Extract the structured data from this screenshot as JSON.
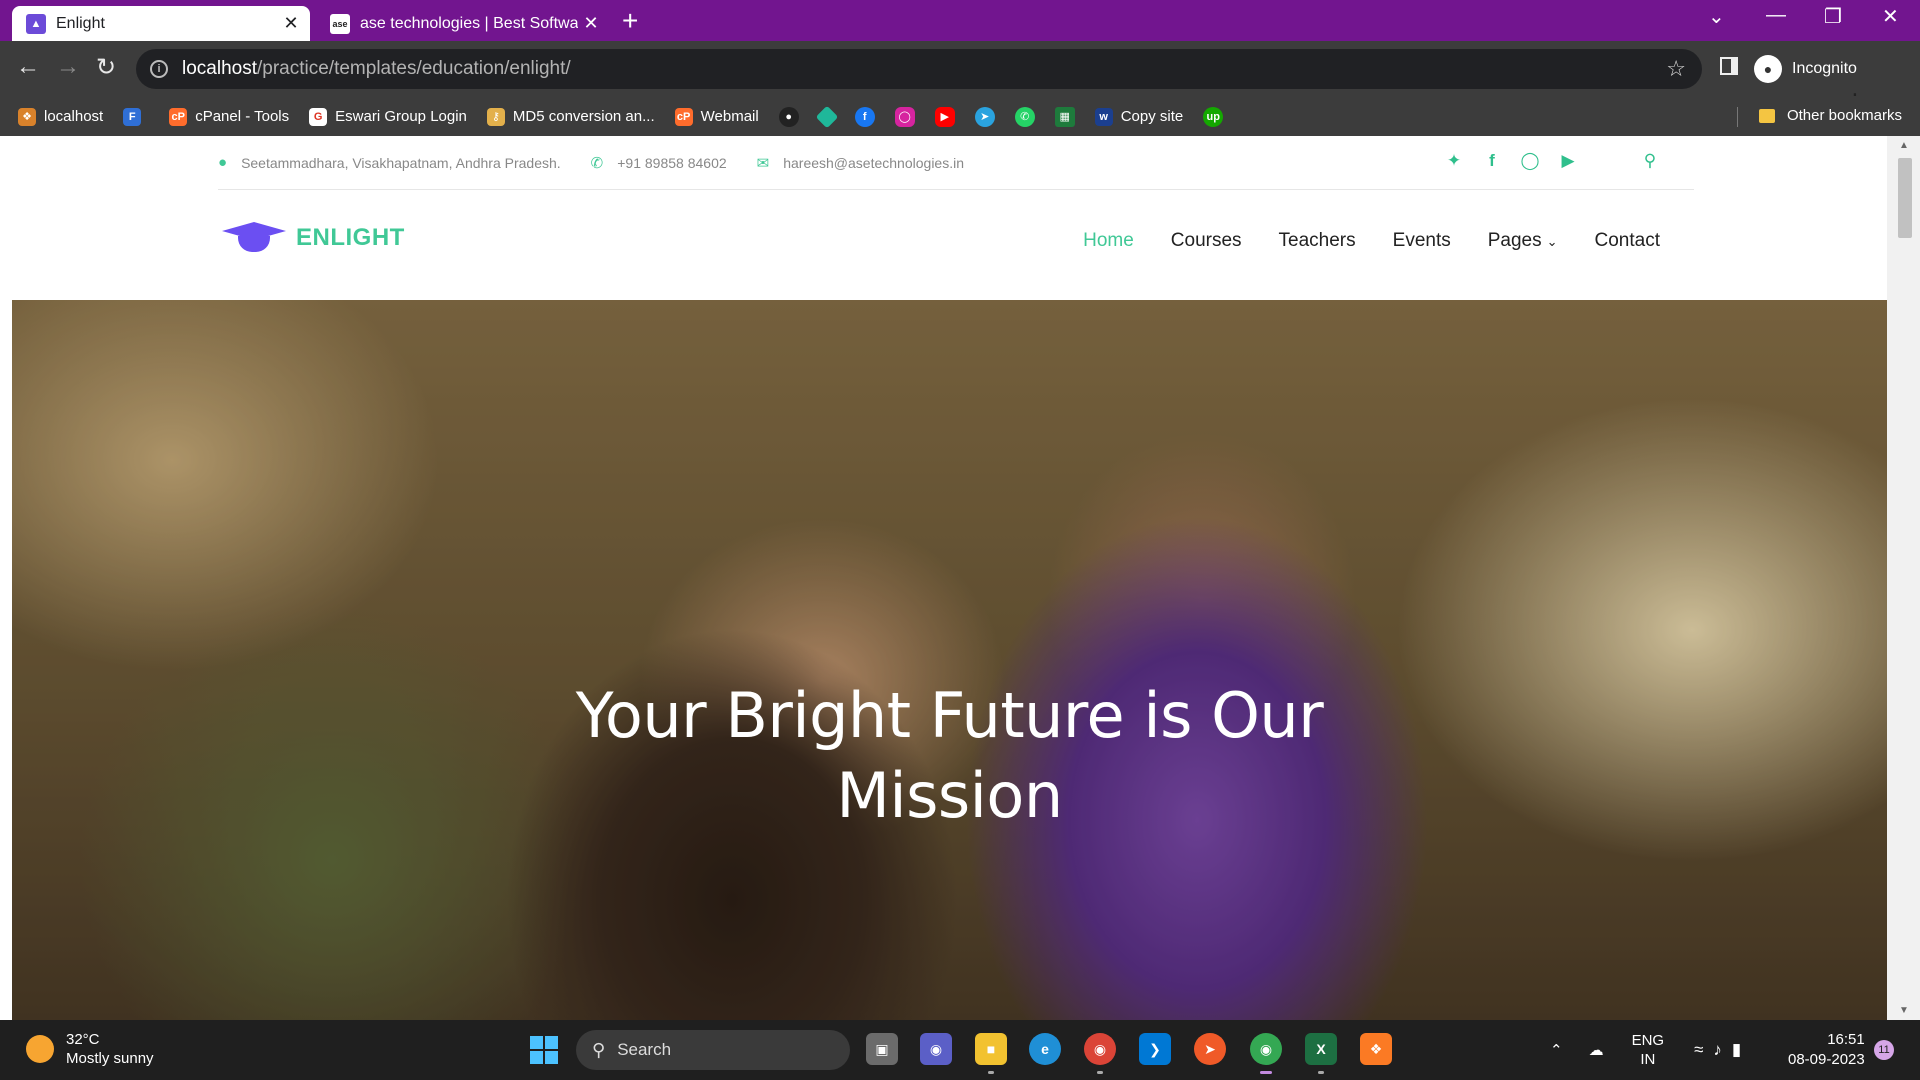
{
  "browser": {
    "tabs": [
      {
        "title": "Enlight",
        "favicon": "graduation-cap-icon",
        "active": true
      },
      {
        "title": "ase technologies | Best Software",
        "favicon": "ase-logo-icon",
        "active": false
      }
    ],
    "url_host": "localhost",
    "url_path": "/practice/templates/education/enlight/",
    "profile_label": "Incognito",
    "colors": {
      "tabbar": "#72158f",
      "toolbar": "#3c3c3c"
    }
  },
  "bookmarks": {
    "items": [
      {
        "label": "localhost",
        "icon": "xampp-icon",
        "color": "#d9822b"
      },
      {
        "label": "",
        "icon": "f-icon",
        "color": "#2f6fd6"
      },
      {
        "label": "cPanel - Tools",
        "icon": "cpanel-icon",
        "color": "#ff6c2c"
      },
      {
        "label": "Eswari Group Login",
        "icon": "eswari-icon",
        "color": "#ffffff"
      },
      {
        "label": "MD5 conversion an...",
        "icon": "key-icon",
        "color": "#e3b04b"
      },
      {
        "label": "Webmail",
        "icon": "cpanel-icon",
        "color": "#ff6c2c"
      }
    ],
    "icon_only": [
      {
        "icon": "github-icon",
        "color": "#222222"
      },
      {
        "icon": "diamond-icon",
        "color": "#1fb89a"
      },
      {
        "icon": "facebook-icon",
        "color": "#1877f2"
      },
      {
        "icon": "instagram-icon",
        "color": "#d6249f"
      },
      {
        "icon": "youtube-icon",
        "color": "#ff0000"
      },
      {
        "icon": "telegram-icon",
        "color": "#2aa3df"
      },
      {
        "icon": "whatsapp-icon",
        "color": "#25d366"
      },
      {
        "icon": "sheet-icon",
        "color": "#1e7b3c"
      }
    ],
    "copy_site": "Copy site",
    "upwork_icon": "upwork-icon",
    "other": "Other bookmarks"
  },
  "site": {
    "topbar": {
      "address": "Seetammadhara, Visakhapatnam, Andhra Pradesh.",
      "phone": "+91 89858 84602",
      "email": "hareesh@asetechnologies.in"
    },
    "logo_text": "ENLIGHT",
    "nav": {
      "home": "Home",
      "courses": "Courses",
      "teachers": "Teachers",
      "events": "Events",
      "pages": "Pages",
      "contact": "Contact"
    },
    "hero_title_line1": "Your Bright Future is Our",
    "hero_title_line2": "Mission",
    "accent_color": "#40c896",
    "logo_color": "#6b4ff2"
  },
  "taskbar": {
    "temperature": "32°C",
    "weather": "Mostly sunny",
    "search_label": "Search",
    "lang_top": "ENG",
    "lang_bottom": "IN",
    "time": "16:51",
    "date": "08-09-2023",
    "notifications": "11"
  }
}
